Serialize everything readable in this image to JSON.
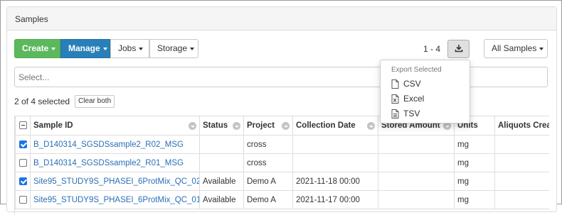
{
  "panel": {
    "title": "Samples"
  },
  "toolbar": {
    "create_label": "Create",
    "manage_label": "Manage",
    "jobs_label": "Jobs",
    "storage_label": "Storage",
    "page_count": "1 - 4",
    "export_icon": "download-icon",
    "view_label": "All Samples"
  },
  "search": {
    "placeholder": "Select..."
  },
  "selection": {
    "text": "2 of 4 selected",
    "clear_label": "Clear both"
  },
  "export_menu": {
    "header": "Export Selected",
    "items": [
      {
        "label": "CSV",
        "icon": "file-icon"
      },
      {
        "label": "Excel",
        "icon": "excel-file-icon"
      },
      {
        "label": "TSV",
        "icon": "file-text-icon"
      }
    ]
  },
  "table": {
    "columns": [
      "Sample ID",
      "Status",
      "Project",
      "Collection Date",
      "Stored Amount",
      "Units",
      "Aliquots Crea"
    ],
    "rows": [
      {
        "checked": true,
        "sample_id": "B_D140314_SGSDSsample2_R02_MSG",
        "status": "",
        "project": "cross",
        "collection_date": "",
        "stored_amount": "",
        "units": "mg",
        "aliquots": ""
      },
      {
        "checked": false,
        "sample_id": "B_D140314_SGSDSsample2_R01_MSG",
        "status": "",
        "project": "cross",
        "collection_date": "",
        "stored_amount": "",
        "units": "mg",
        "aliquots": ""
      },
      {
        "checked": true,
        "sample_id": "Site95_STUDY9S_PHASEI_6ProtMix_QC_02",
        "status": "Available",
        "project": "Demo A",
        "collection_date": "2021-11-18 00:00",
        "stored_amount": "",
        "units": "mg",
        "aliquots": ""
      },
      {
        "checked": false,
        "sample_id": "Site95_STUDY9S_PHASEI_6ProtMix_QC_01",
        "status": "Available",
        "project": "Demo A",
        "collection_date": "2021-11-17 00:00",
        "stored_amount": "",
        "units": "mg",
        "aliquots": ""
      }
    ]
  }
}
